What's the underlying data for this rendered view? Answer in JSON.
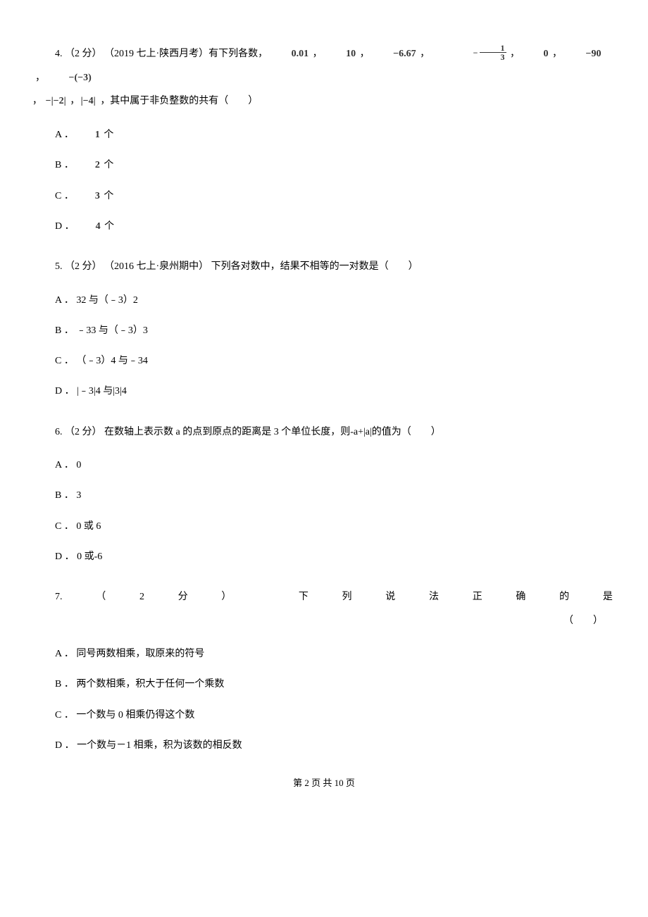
{
  "q4": {
    "stem_prefix": "4. （2 分） （2019 七上·陕西月考）有下列各数，",
    "nums": [
      "0.01",
      "10",
      "−6.67",
      "−1/3",
      "0",
      "−90",
      "−(−3)"
    ],
    "nums2": [
      "−|−2|",
      "|−4|"
    ],
    "stem_suffix": "，其中属于非负整数的共有（　　）",
    "options": {
      "a_label": "A ．",
      "a_val": "1",
      "a_suffix": " 个",
      "b_label": "B ．",
      "b_val": "2",
      "b_suffix": " 个",
      "c_label": "C ．",
      "c_val": "3",
      "c_suffix": " 个",
      "d_label": "D ．",
      "d_val": "4",
      "d_suffix": " 个"
    }
  },
  "q5": {
    "stem": "5. （2 分） （2016 七上·泉州期中） 下列各对数中，结果不相等的一对数是（　　）",
    "options": {
      "a": "A ． 32 与（﹣3）2",
      "b": "B ． ﹣33 与（﹣3）3",
      "c": "C ． （﹣3）4 与﹣34",
      "d": "D ． |﹣3|4 与|3|4"
    }
  },
  "q6": {
    "stem": "6. （2 分）  在数轴上表示数 a 的点到原点的距离是 3 个单位长度，则-a+|a|的值为（　　）",
    "options": {
      "a": "A ． 0",
      "b": "B ． 3",
      "c": "C ． 0 或 6",
      "d": "D ． 0 或-6"
    }
  },
  "q7": {
    "stem_chars": [
      "7.",
      "（",
      "2",
      "分",
      "）",
      "",
      "下",
      "列",
      "说",
      "法",
      "正",
      "确",
      "的",
      "是"
    ],
    "paren": "（　　）",
    "options": {
      "a": "A ． 同号两数相乘，取原来的符号",
      "b": "B ． 两个数相乘，积大于任何一个乘数",
      "c": "C ． 一个数与 0 相乘仍得这个数",
      "d": "D ． 一个数与－1 相乘，积为该数的相反数"
    }
  },
  "footer": "第 2 页 共 10 页"
}
